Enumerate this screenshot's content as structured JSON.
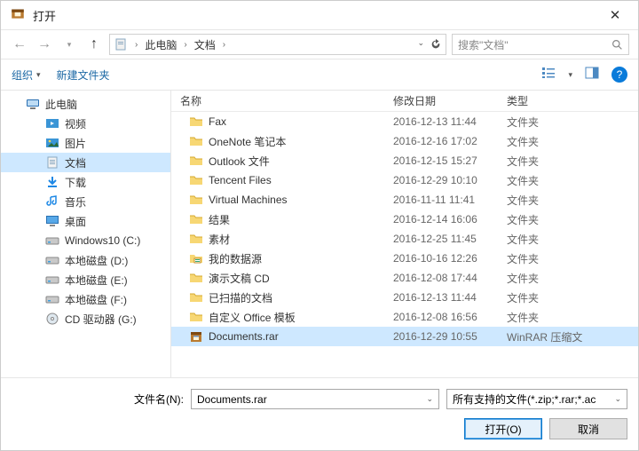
{
  "title": "打开",
  "breadcrumb": {
    "pc": "此电脑",
    "docs": "文档"
  },
  "search": {
    "placeholder": "搜索\"文档\""
  },
  "toolbar": {
    "organize": "组织",
    "newfolder": "新建文件夹"
  },
  "tree": [
    {
      "label": "此电脑",
      "icon": "pc",
      "indent": 0,
      "selected": false
    },
    {
      "label": "视频",
      "icon": "video",
      "indent": 1,
      "selected": false
    },
    {
      "label": "图片",
      "icon": "picture",
      "indent": 1,
      "selected": false
    },
    {
      "label": "文档",
      "icon": "document",
      "indent": 1,
      "selected": true
    },
    {
      "label": "下载",
      "icon": "download",
      "indent": 1,
      "selected": false
    },
    {
      "label": "音乐",
      "icon": "music",
      "indent": 1,
      "selected": false
    },
    {
      "label": "桌面",
      "icon": "desktop",
      "indent": 1,
      "selected": false
    },
    {
      "label": "Windows10 (C:)",
      "icon": "disk",
      "indent": 1,
      "selected": false
    },
    {
      "label": "本地磁盘 (D:)",
      "icon": "disk",
      "indent": 1,
      "selected": false
    },
    {
      "label": "本地磁盘 (E:)",
      "icon": "disk",
      "indent": 1,
      "selected": false
    },
    {
      "label": "本地磁盘 (F:)",
      "icon": "disk",
      "indent": 1,
      "selected": false
    },
    {
      "label": "CD 驱动器 (G:)",
      "icon": "cd",
      "indent": 1,
      "selected": false
    }
  ],
  "columns": {
    "name": "名称",
    "date": "修改日期",
    "type": "类型"
  },
  "files": [
    {
      "name": "Fax",
      "date": "2016-12-13 11:44",
      "type": "文件夹",
      "icon": "folder",
      "selected": false
    },
    {
      "name": "OneNote 笔记本",
      "date": "2016-12-16 17:02",
      "type": "文件夹",
      "icon": "folder",
      "selected": false
    },
    {
      "name": "Outlook 文件",
      "date": "2016-12-15 15:27",
      "type": "文件夹",
      "icon": "folder",
      "selected": false
    },
    {
      "name": "Tencent Files",
      "date": "2016-12-29 10:10",
      "type": "文件夹",
      "icon": "folder",
      "selected": false
    },
    {
      "name": "Virtual Machines",
      "date": "2016-11-11 11:41",
      "type": "文件夹",
      "icon": "folder",
      "selected": false
    },
    {
      "name": "结果",
      "date": "2016-12-14 16:06",
      "type": "文件夹",
      "icon": "folder",
      "selected": false
    },
    {
      "name": "素材",
      "date": "2016-12-25 11:45",
      "type": "文件夹",
      "icon": "folder",
      "selected": false
    },
    {
      "name": "我的数据源",
      "date": "2016-10-16 12:26",
      "type": "文件夹",
      "icon": "datasource",
      "selected": false
    },
    {
      "name": "演示文稿 CD",
      "date": "2016-12-08 17:44",
      "type": "文件夹",
      "icon": "folder",
      "selected": false
    },
    {
      "name": "已扫描的文档",
      "date": "2016-12-13 11:44",
      "type": "文件夹",
      "icon": "folder",
      "selected": false
    },
    {
      "name": "自定义 Office 模板",
      "date": "2016-12-08 16:56",
      "type": "文件夹",
      "icon": "folder",
      "selected": false
    },
    {
      "name": "Documents.rar",
      "date": "2016-12-29 10:55",
      "type": "WinRAR 压缩文",
      "icon": "rar",
      "selected": true
    }
  ],
  "filename": {
    "label": "文件名(N):",
    "value": "Documents.rar"
  },
  "filter": {
    "label": "所有支持的文件(*.zip;*.rar;*.ac"
  },
  "buttons": {
    "open": "打开(O)",
    "cancel": "取消"
  }
}
